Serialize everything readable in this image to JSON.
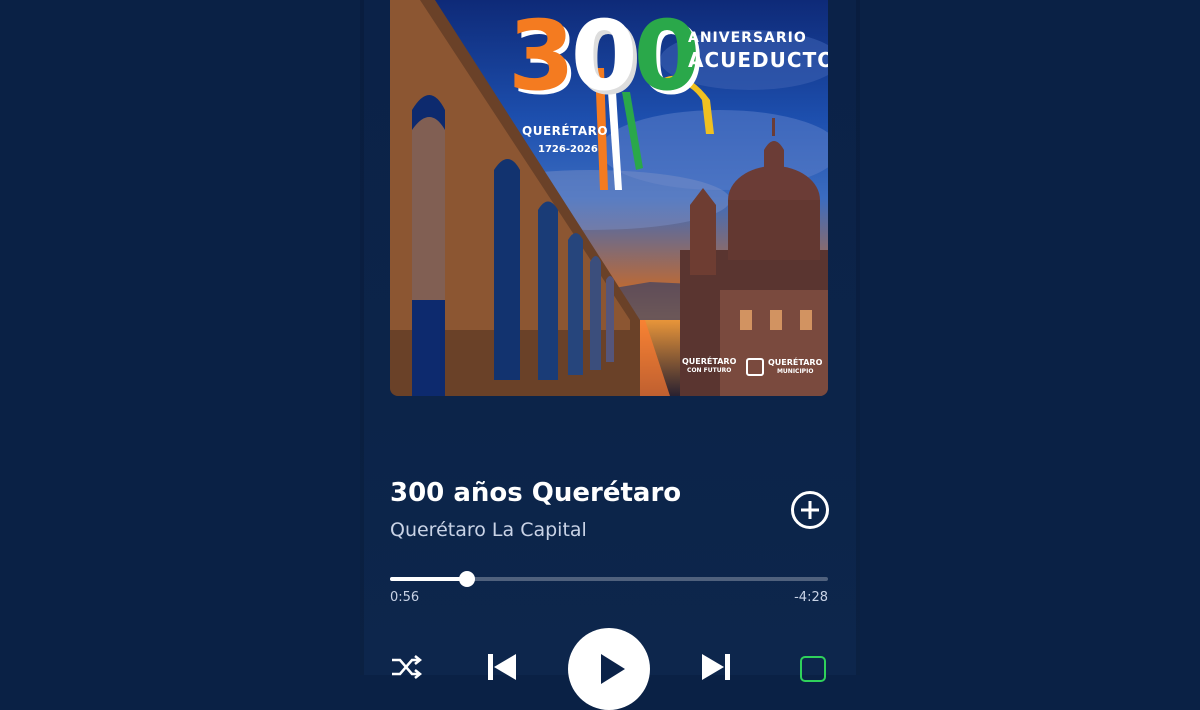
{
  "album_art": {
    "logo_number": [
      "3",
      "0",
      "0"
    ],
    "logo_anniversary": "ANIVERSARIO",
    "logo_acueducto": "ACUEDUCTO",
    "logo_city": "QUERÉTARO",
    "logo_years": "1726-2026",
    "badge_left_main": "QUERÉTARO",
    "badge_left_sub": "CON FUTURO",
    "badge_right_main": "QUERÉTARO",
    "badge_right_sub": "MUNICIPIO"
  },
  "track": {
    "title": "300 años Querétaro",
    "artist": "Querétaro La Capital"
  },
  "progress": {
    "elapsed": "0:56",
    "remaining": "-4:28",
    "fraction": 0.176
  },
  "controls": {
    "shuffle_icon": "shuffle-icon",
    "previous_icon": "skip-previous-icon",
    "play_icon": "play-icon",
    "next_icon": "skip-next-icon",
    "repeat_icon": "repeat-icon",
    "add_icon": "add-circle-icon",
    "active_color": "#2fd15b"
  },
  "colors": {
    "background": "#0a2145",
    "text_primary": "#ffffff",
    "text_secondary": "#c9d3e6"
  }
}
